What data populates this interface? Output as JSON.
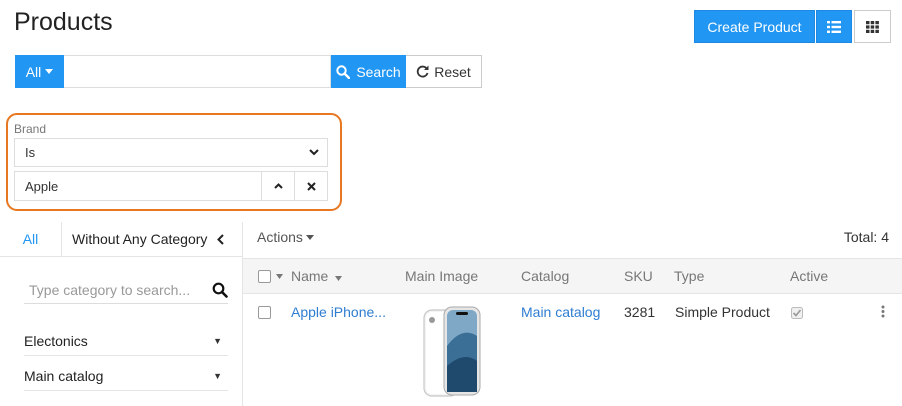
{
  "header": {
    "title": "Products",
    "create_label": "Create Product"
  },
  "search": {
    "all_label": "All",
    "placeholder": "",
    "value": "",
    "search_label": "Search",
    "reset_label": "Reset"
  },
  "filter": {
    "label": "Brand",
    "operator": "Is",
    "value": "Apple"
  },
  "categories": {
    "tab_all": "All",
    "tab_without": "Without Any Category",
    "search_placeholder": "Type category to search...",
    "items": [
      {
        "label": "Electonics"
      },
      {
        "label": "Main catalog"
      }
    ]
  },
  "toolbar": {
    "actions_label": "Actions",
    "total_label": "Total: 4"
  },
  "table": {
    "columns": [
      "Name",
      "Main Image",
      "Catalog",
      "SKU",
      "Type",
      "Active"
    ],
    "rows": [
      {
        "name": "Apple iPhone...",
        "catalog": "Main catalog",
        "sku": "3281",
        "type": "Simple Product",
        "active": true
      }
    ]
  },
  "colors": {
    "accent": "#2196f3",
    "highlight": "#e87722",
    "link": "#2e7dd1"
  },
  "icons": [
    "caret-down-icon",
    "list-view-icon",
    "grid-view-icon",
    "search-icon",
    "refresh-icon",
    "chevron-down-icon",
    "chevron-up-icon",
    "close-icon",
    "chevron-left-icon",
    "checkbox-icon",
    "kebab-menu-icon",
    "sort-caret-icon"
  ]
}
